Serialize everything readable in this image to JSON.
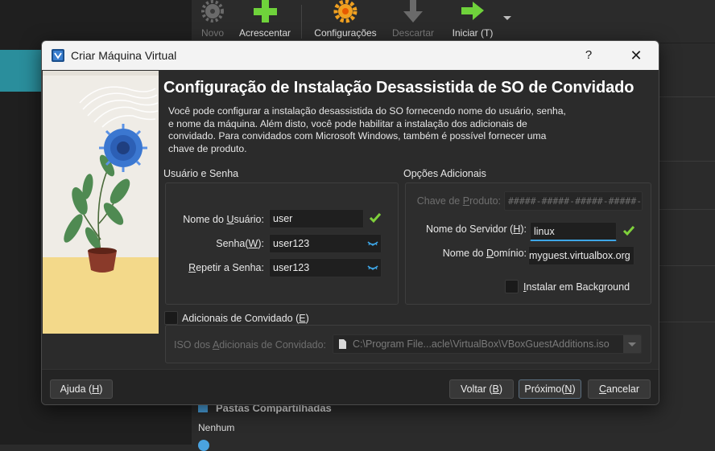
{
  "toolbar": {
    "items": [
      {
        "label": "Novo",
        "icon": "gear-icon",
        "enabled": false
      },
      {
        "label": "Acrescentar",
        "icon": "plus-icon",
        "enabled": true
      },
      {
        "label": "Configurações",
        "icon": "settings-gear-icon",
        "enabled": true
      },
      {
        "label": "Descartar",
        "icon": "discard-arrow-icon",
        "enabled": false
      },
      {
        "label": "Iniciar (T)",
        "icon": "start-arrow-icon",
        "enabled": true
      }
    ]
  },
  "background": {
    "section_title": "Pastas Compartilhadas",
    "section_value": "Nenhum"
  },
  "dialog": {
    "title": "Criar Máquina Virtual",
    "help_label": "?",
    "close_label": "✕",
    "heading": "Configuração de Instalação Desassistida de SO de Convidado",
    "description_lines": [
      "Você pode configurar a instalação desassistida do SO fornecendo nome do usuário, senha,",
      "e nome da máquina. Além disto, você pode habilitar a instalação dos adicionais de",
      "convidado. Para convidados com Microsoft Windows, também é possível fornecer uma",
      "chave de produto."
    ],
    "user_group": {
      "title": "Usuário e Senha",
      "username_label": [
        "Nome do ",
        "U",
        "suário:"
      ],
      "username_value": "user",
      "password_label": [
        "Senha(",
        "W",
        "):"
      ],
      "password_value": "user123",
      "repeat_label": [
        "",
        "R",
        "epetir a Senha:"
      ],
      "repeat_value": "user123"
    },
    "additional_group": {
      "title": "Opções Adicionais",
      "product_key_label": [
        "Chave de ",
        "P",
        "roduto:"
      ],
      "product_key_placeholder": "#####-#####-#####-#####-#####",
      "hostname_label": [
        "Nome do Servidor (",
        "H",
        "):"
      ],
      "hostname_value": "linux",
      "domain_label": [
        "Nome do ",
        "D",
        "omínio:"
      ],
      "domain_value": "myguest.virtualbox.org",
      "install_bg_label": [
        "",
        "I",
        "nstalar em Background"
      ],
      "install_bg_checked": false
    },
    "guest_additions": {
      "label": [
        "Adicionais de Convidado (",
        "E",
        ")"
      ],
      "checked": false,
      "iso_label": [
        "ISO dos ",
        "A",
        "dicionais de Convidado:"
      ],
      "iso_value": "C:\\Program File...acle\\VirtualBox\\VBoxGuestAdditions.iso"
    },
    "buttons": {
      "help": [
        "Ajuda (",
        "H",
        ")"
      ],
      "back": [
        "Voltar (",
        "B",
        ")"
      ],
      "next": [
        "Próximo(",
        "N",
        ")"
      ],
      "cancel": [
        "",
        "C",
        "ancelar"
      ]
    }
  },
  "colors": {
    "accent": "#3ea6e6",
    "check_green": "#7fd13b",
    "selected_vm": "#2a8e9c",
    "illustration_floor": "#f3d98a"
  }
}
